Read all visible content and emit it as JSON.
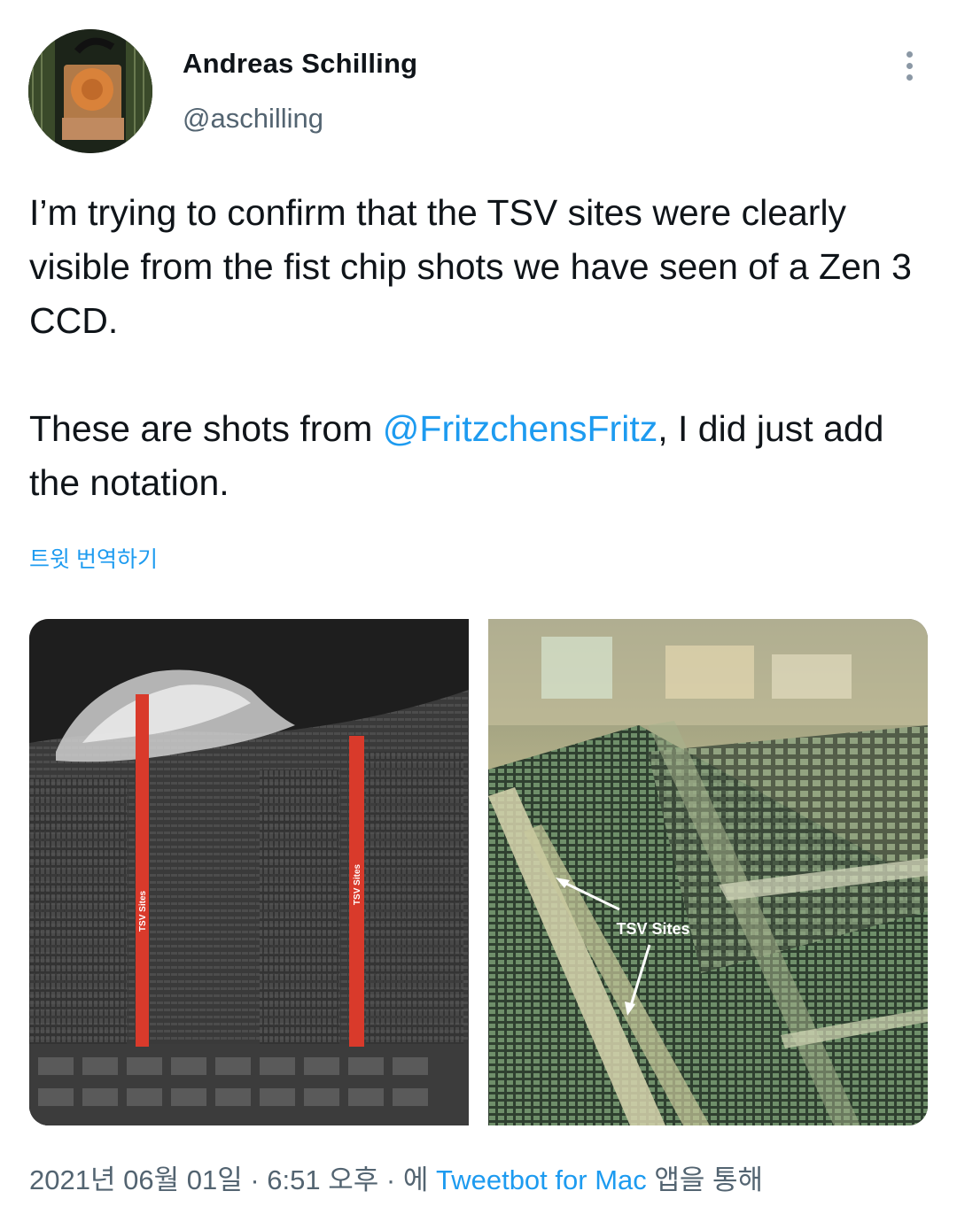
{
  "author": {
    "name": "Andreas Schilling",
    "handle": "@aschilling"
  },
  "tweet": {
    "text_line1": "I’m trying to confirm that the TSV sites were clearly visible from the fist chip shots we have seen of a Zen 3 CCD.",
    "text2_before": "These are shots from ",
    "mention": "@FritzchensFritz",
    "text2_after": ", I did just add the notation.",
    "translate_label": "트윗 번역하기"
  },
  "media": {
    "left_labels": [
      "TSV Sites",
      "TSV Sites"
    ],
    "right_label": "TSV Sites"
  },
  "footer": {
    "date": "2021년 06월 01일",
    "separator1": " · ",
    "time": "6:51 오후",
    "separator2": " · ",
    "via_prefix": "에 ",
    "source": "Tweetbot for Mac",
    "via_suffix": " 앱을 통해"
  },
  "colors": {
    "link": "#1d9bf0",
    "secondary_text": "#536471",
    "tsv_marker": "#d93a2b"
  },
  "icons": {
    "more": "more-vertical-icon"
  }
}
